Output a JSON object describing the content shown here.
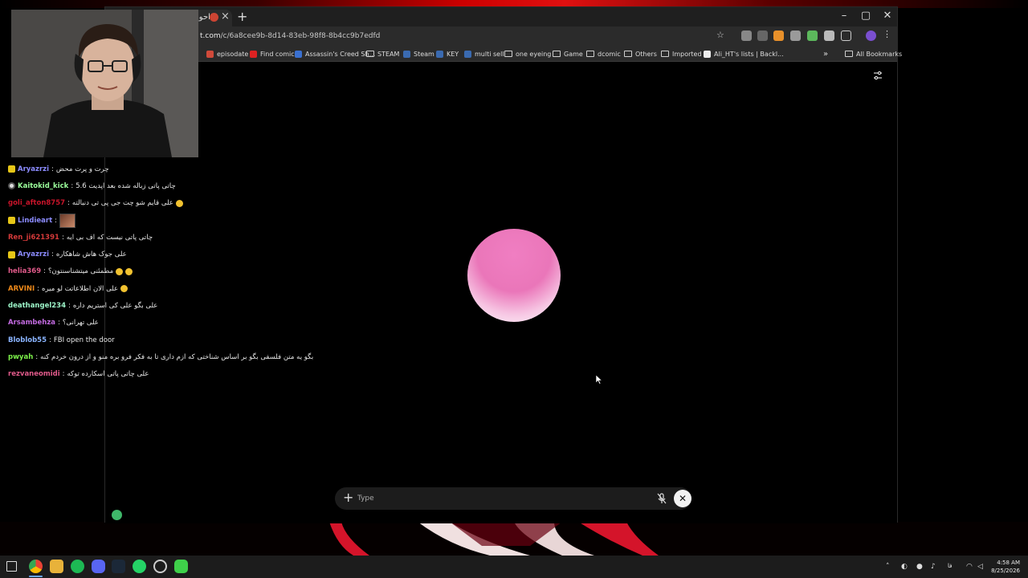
{
  "browser": {
    "tab_title": "احوا",
    "url_host": "t.com",
    "url_path": "/c/6a8cee9b-8d14-83eb-98f8-8b4cc9b7edfd",
    "bookmarks": [
      "episodate",
      "Find comic",
      "Assassin's Creed Sh...",
      "STEAM",
      "Steam",
      "KEY",
      "multi sell",
      "one eyeing",
      "Game",
      "dcomic",
      "Others",
      "Imported",
      "Ali_HT's lists | Backl..."
    ],
    "more_bookmarks": "»",
    "all_bookmarks": "All Bookmarks"
  },
  "composer": {
    "plus": "+",
    "placeholder": "Type",
    "close": "✕"
  },
  "chat": [
    {
      "user": "Aryazrzi",
      "color": "#8c8cff",
      "text": "چرت و پرت محض",
      "badge": "10"
    },
    {
      "user": "Kaitokid_kick",
      "color": "#9cff9c",
      "text": "چاتی پاتی زباله شده بعد اپدیت 5.6",
      "badge": "round"
    },
    {
      "user": "goli_afton8757",
      "color": "#c8142a",
      "text": "علی قایم شو چت جی پی تی دنبالته",
      "badge": ""
    },
    {
      "user": "Lindieart",
      "color": "#8c8cff",
      "text": "",
      "badge": "10"
    },
    {
      "user": "Ren_ji621391",
      "color": "#d43a3a",
      "text": "چاتی پاتی نیست که اف بی ایه",
      "badge": ""
    },
    {
      "user": "Aryazrzi",
      "color": "#8c8cff",
      "text": "علی جوک هاش شاهکاره",
      "badge": "10"
    },
    {
      "user": "helia369",
      "color": "#e05a8a",
      "text": "مطمئنی میتشناسنتون؟",
      "badge": ""
    },
    {
      "user": "ARVINI",
      "color": "#f08a1a",
      "text": "علی الان اطلاعاتت لو میره",
      "badge": ""
    },
    {
      "user": "deathangel234",
      "color": "#9cf4c8",
      "text": "علی بگو علی کی استریم داره",
      "badge": ""
    },
    {
      "user": "Arsambehza",
      "color": "#c26ae0",
      "text": "علی تهرانی؟",
      "badge": ""
    },
    {
      "user": "Bloblob55",
      "color": "#8ab4ff",
      "text": "FBI open the door",
      "badge": ""
    },
    {
      "user": "pwyah",
      "color": "#7cf04a",
      "text": "بگو یه متن فلسفی بگو بر اساس شناختی که ازم داری تا به فکر فرو بره منو و از درون خردم کنه",
      "badge": ""
    },
    {
      "user": "rezvaneomidi",
      "color": "#e05a8a",
      "text": "علی چاتی پاتی اسکارده توکه",
      "badge": ""
    }
  ],
  "taskbar": {
    "time": "4:58 AM",
    "date": "8/25/2026",
    "lang": "فا"
  }
}
